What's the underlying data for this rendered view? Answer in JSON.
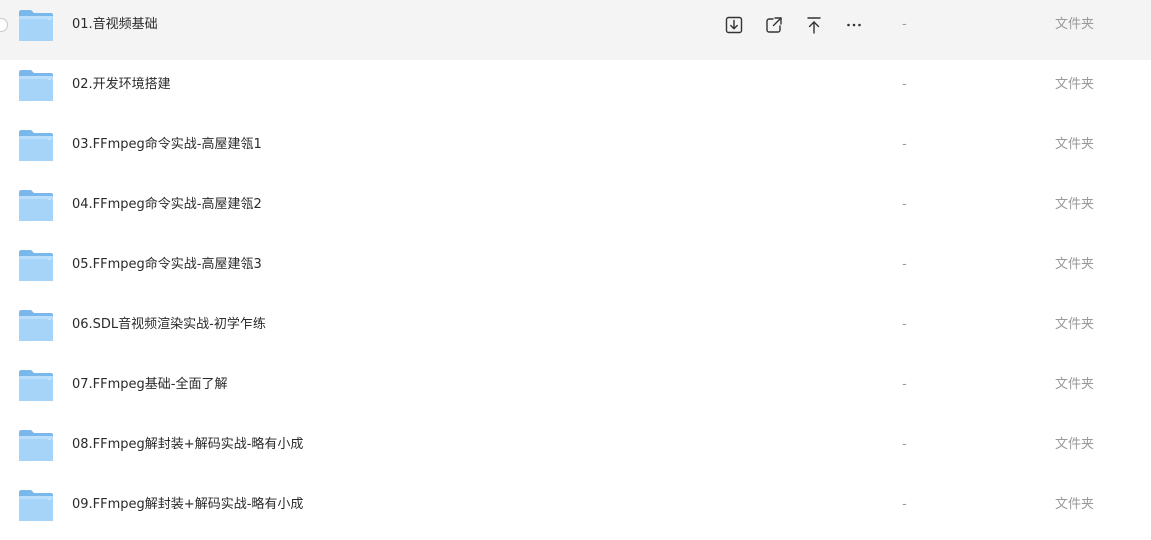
{
  "files": [
    {
      "name": "01.音视频基础",
      "size": "-",
      "type": "文件夹",
      "icon": "folder-icon"
    },
    {
      "name": "02.开发环境搭建",
      "size": "-",
      "type": "文件夹",
      "icon": "folder-icon"
    },
    {
      "name": "03.FFmpeg命令实战-高屋建瓴1",
      "size": "-",
      "type": "文件夹",
      "icon": "folder-icon"
    },
    {
      "name": "04.FFmpeg命令实战-高屋建瓴2",
      "size": "-",
      "type": "文件夹",
      "icon": "folder-icon"
    },
    {
      "name": "05.FFmpeg命令实战-高屋建瓴3",
      "size": "-",
      "type": "文件夹",
      "icon": "folder-icon"
    },
    {
      "name": "06.SDL音视频渲染实战-初学乍练",
      "size": "-",
      "type": "文件夹",
      "icon": "folder-icon"
    },
    {
      "name": "07.FFmpeg基础-全面了解",
      "size": "-",
      "type": "文件夹",
      "icon": "folder-icon"
    },
    {
      "name": "08.FFmpeg解封装+解码实战-略有小成",
      "size": "-",
      "type": "文件夹",
      "icon": "folder-icon"
    },
    {
      "name": "09.FFmpeg解封装+解码实战-略有小成",
      "size": "-",
      "type": "文件夹",
      "icon": "folder-icon"
    }
  ],
  "hover_row": 0,
  "row_actions": [
    {
      "name": "download-icon"
    },
    {
      "name": "share-icon"
    },
    {
      "name": "upload-icon"
    },
    {
      "name": "more-icon"
    }
  ],
  "colors": {
    "folder_back": "#7ab8ec",
    "folder_front": "#a6d3f8",
    "hover_bg": "#f4f4f5",
    "muted_text": "#9a9a9a"
  }
}
